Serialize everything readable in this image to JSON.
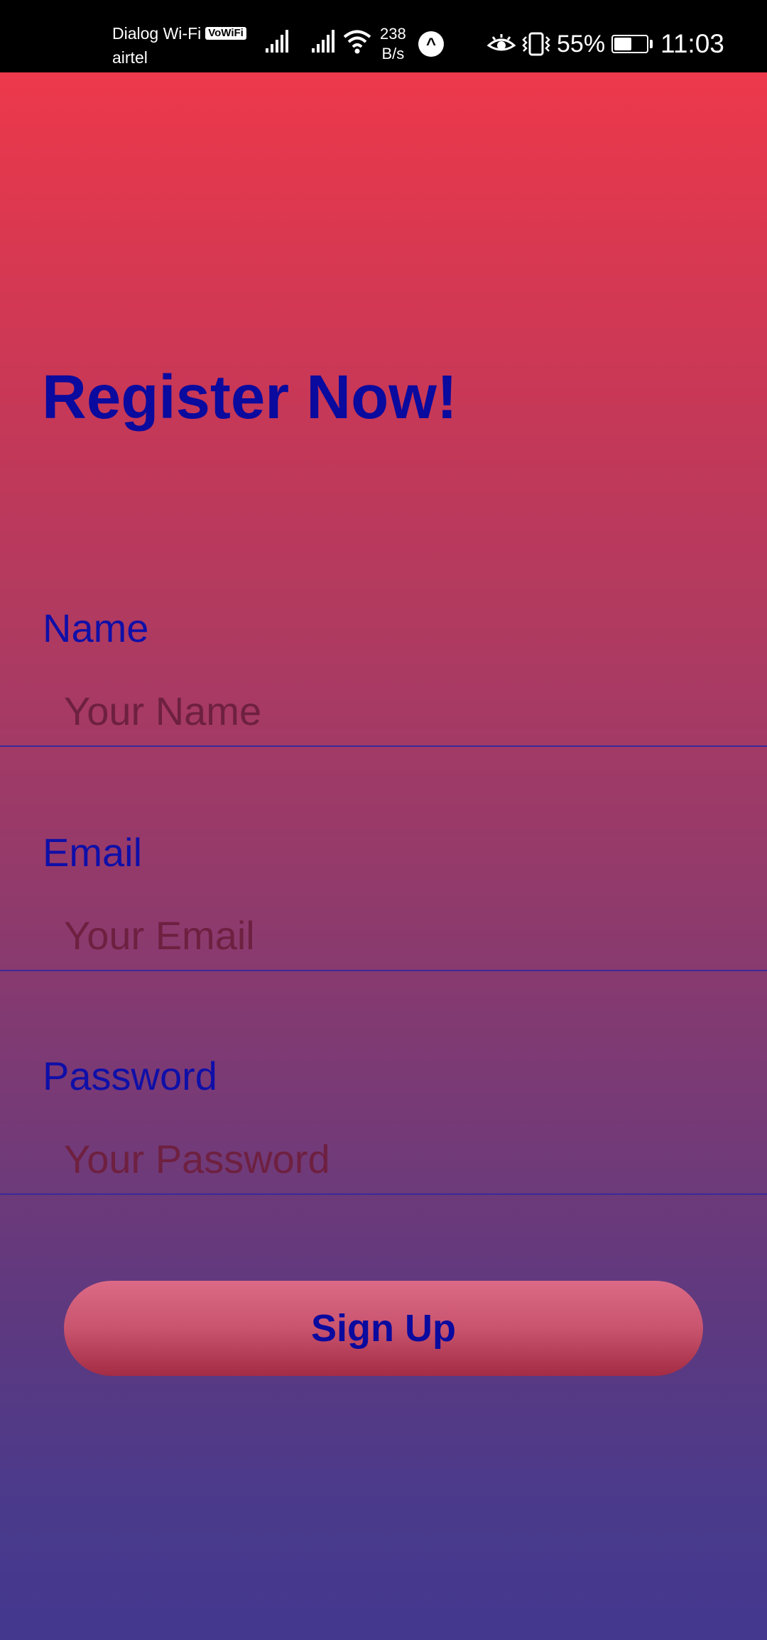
{
  "status_bar": {
    "carrier_1": "Dialog Wi-Fi",
    "vowifi_badge": "VoWiFi",
    "carrier_2": "airtel",
    "speed_value": "238",
    "speed_unit": "B/s",
    "app_icon_glyph": "^",
    "battery_percent": "55%",
    "battery_level": 0.55,
    "time": "11:03",
    "icons": [
      "signal-icon",
      "signal-icon",
      "wifi-icon",
      "eye-comfort-icon",
      "vibrate-icon",
      "battery-charging-icon"
    ]
  },
  "page": {
    "title": "Register Now!"
  },
  "form": {
    "name": {
      "label": "Name",
      "placeholder": "Your Name",
      "value": ""
    },
    "email": {
      "label": "Email",
      "placeholder": "Your Email",
      "value": ""
    },
    "password": {
      "label": "Password",
      "placeholder": "Your Password",
      "value": ""
    },
    "submit_label": "Sign Up"
  },
  "colors": {
    "gradient_top": "#f63a48",
    "gradient_bottom": "#43388e",
    "text_accent": "#0a0a9e",
    "button_top": "#dc6a86",
    "button_bottom": "#a42c44"
  }
}
